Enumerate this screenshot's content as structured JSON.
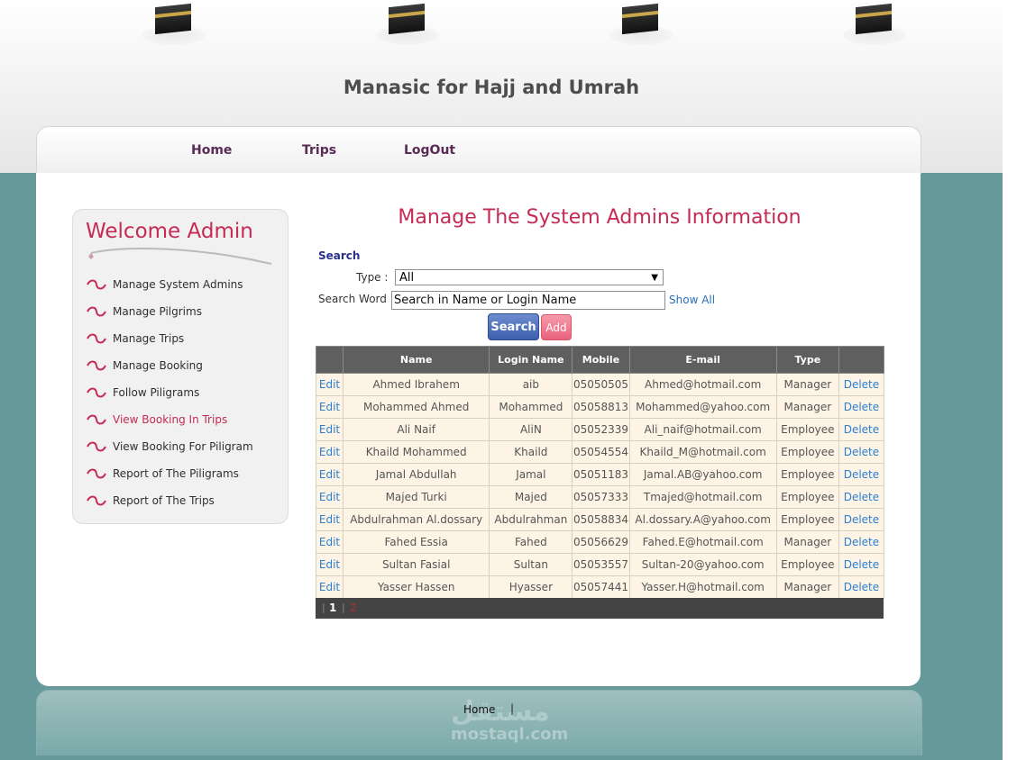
{
  "site": {
    "title": "Manasic for Hajj and Umrah"
  },
  "nav": {
    "items": [
      {
        "label": "Home"
      },
      {
        "label": "Trips"
      },
      {
        "label": "LogOut"
      }
    ]
  },
  "sidebar": {
    "welcome": "Welcome Admin",
    "items": [
      {
        "label": "Manage System Admins"
      },
      {
        "label": "Manage Pilgrims"
      },
      {
        "label": "Manage Trips"
      },
      {
        "label": "Manage Booking"
      },
      {
        "label": "Follow Piligrams"
      },
      {
        "label": "View Booking In Trips"
      },
      {
        "label": "View Booking For Piligram"
      },
      {
        "label": "Report of The Piligrams"
      },
      {
        "label": "Report of The Trips"
      }
    ]
  },
  "main": {
    "heading": "Manage The System Admins Information",
    "search": {
      "title": "Search",
      "type_label": "Type :",
      "type_value": "All",
      "word_label": "Search Word :",
      "word_value": "Search in Name or Login Name",
      "show_all": "Show All",
      "search_button": "Search",
      "add_button": "Add"
    },
    "table": {
      "headers": [
        "",
        "Name",
        "Login Name",
        "Mobile",
        "E-mail",
        "Type",
        ""
      ],
      "edit_label": "Edit",
      "delete_label": "Delete",
      "rows": [
        {
          "name": "Ahmed Ibrahem",
          "login": "aib",
          "mobile": "05050505",
          "email": "Ahmed@hotmail.com",
          "type": "Manager"
        },
        {
          "name": "Mohammed Ahmed",
          "login": "Mohammed",
          "mobile": "05058813",
          "email": "Mohammed@yahoo.com",
          "type": "Manager"
        },
        {
          "name": "Ali Naif",
          "login": "AliN",
          "mobile": "05052339",
          "email": "Ali_naif@hotmail.com",
          "type": "Employee"
        },
        {
          "name": "Khaild Mohammed",
          "login": "Khaild",
          "mobile": "05054554",
          "email": "Khaild_M@hotmail.com",
          "type": "Employee"
        },
        {
          "name": "Jamal Abdullah",
          "login": "Jamal",
          "mobile": "05051183",
          "email": "Jamal.AB@yahoo.com",
          "type": "Employee"
        },
        {
          "name": "Majed Turki",
          "login": "Majed",
          "mobile": "05057333",
          "email": "Tmajed@hotmail.com",
          "type": "Employee"
        },
        {
          "name": "Abdulrahman Al.dossary",
          "login": "Abdulrahman",
          "mobile": "05058834",
          "email": "Al.dossary.A@yahoo.com",
          "type": "Employee"
        },
        {
          "name": "Fahed Essia",
          "login": "Fahed",
          "mobile": "05056629",
          "email": "Fahed.E@hotmail.com",
          "type": "Manager"
        },
        {
          "name": "Sultan Fasial",
          "login": "Sultan",
          "mobile": "05053557",
          "email": "Sultan-20@yahoo.com",
          "type": "Employee"
        },
        {
          "name": "Yasser Hassen",
          "login": "Hyasser",
          "mobile": "05057441",
          "email": "Yasser.H@hotmail.com",
          "type": "Manager"
        }
      ],
      "pager": {
        "current": "1",
        "next": "2"
      }
    }
  },
  "footer": {
    "link": "Home",
    "separator": "|",
    "watermark_ar": "مستقل",
    "watermark_en": "mostaql.com"
  },
  "colors": {
    "accent": "#c62a56",
    "teal": "#669a9a",
    "link": "#2a7fd1",
    "nav": "#5a2b55"
  }
}
